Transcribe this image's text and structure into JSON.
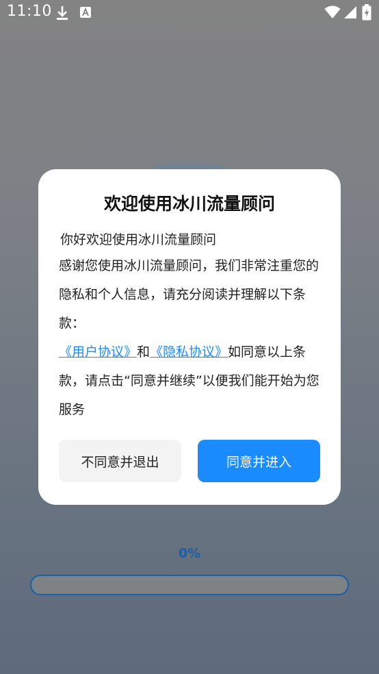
{
  "status_bar": {
    "time": "11:10",
    "icons": [
      "download-icon",
      "autofill-icon",
      "wifi-icon",
      "signal-icon",
      "battery-icon"
    ]
  },
  "dialog": {
    "title": "欢迎使用冰川流量顾问",
    "greeting": "你好欢迎使用冰川流量顾问",
    "paragraph": "感谢您使用冰川流量顾问，我们非常注重您的隐私和个人信息，请充分阅读并理解以下条款：",
    "user_agreement_link": "《用户协议》",
    "conjunction": "和",
    "privacy_link": "《隐私协议》",
    "consent_text": "如同意以上条款，请点击“同意并继续”以便我们能开始为您服务",
    "disagree_button": "不同意并退出",
    "agree_button": "同意并进入"
  },
  "progress": {
    "label": "0%",
    "value": 0
  },
  "colors": {
    "accent": "#1a8cff",
    "progress_text": "#1a5fa8",
    "dialog_bg": "#ffffff",
    "disagree_bg": "#f3f3f3"
  }
}
